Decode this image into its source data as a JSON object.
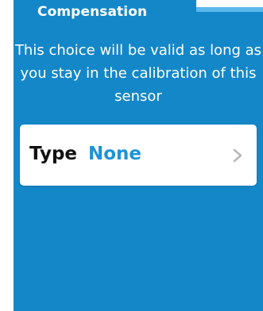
{
  "header": {
    "title": "Compensation"
  },
  "content": {
    "description": "This choice will be valid as long as you stay in the calibration of this sensor"
  },
  "type_setting": {
    "label": "Type",
    "value": "None"
  },
  "icons": {
    "chevron": "chevron-right-icon"
  },
  "colors": {
    "panel": "#1487c8",
    "accent": "#1c93d6",
    "card": "#ffffff"
  }
}
